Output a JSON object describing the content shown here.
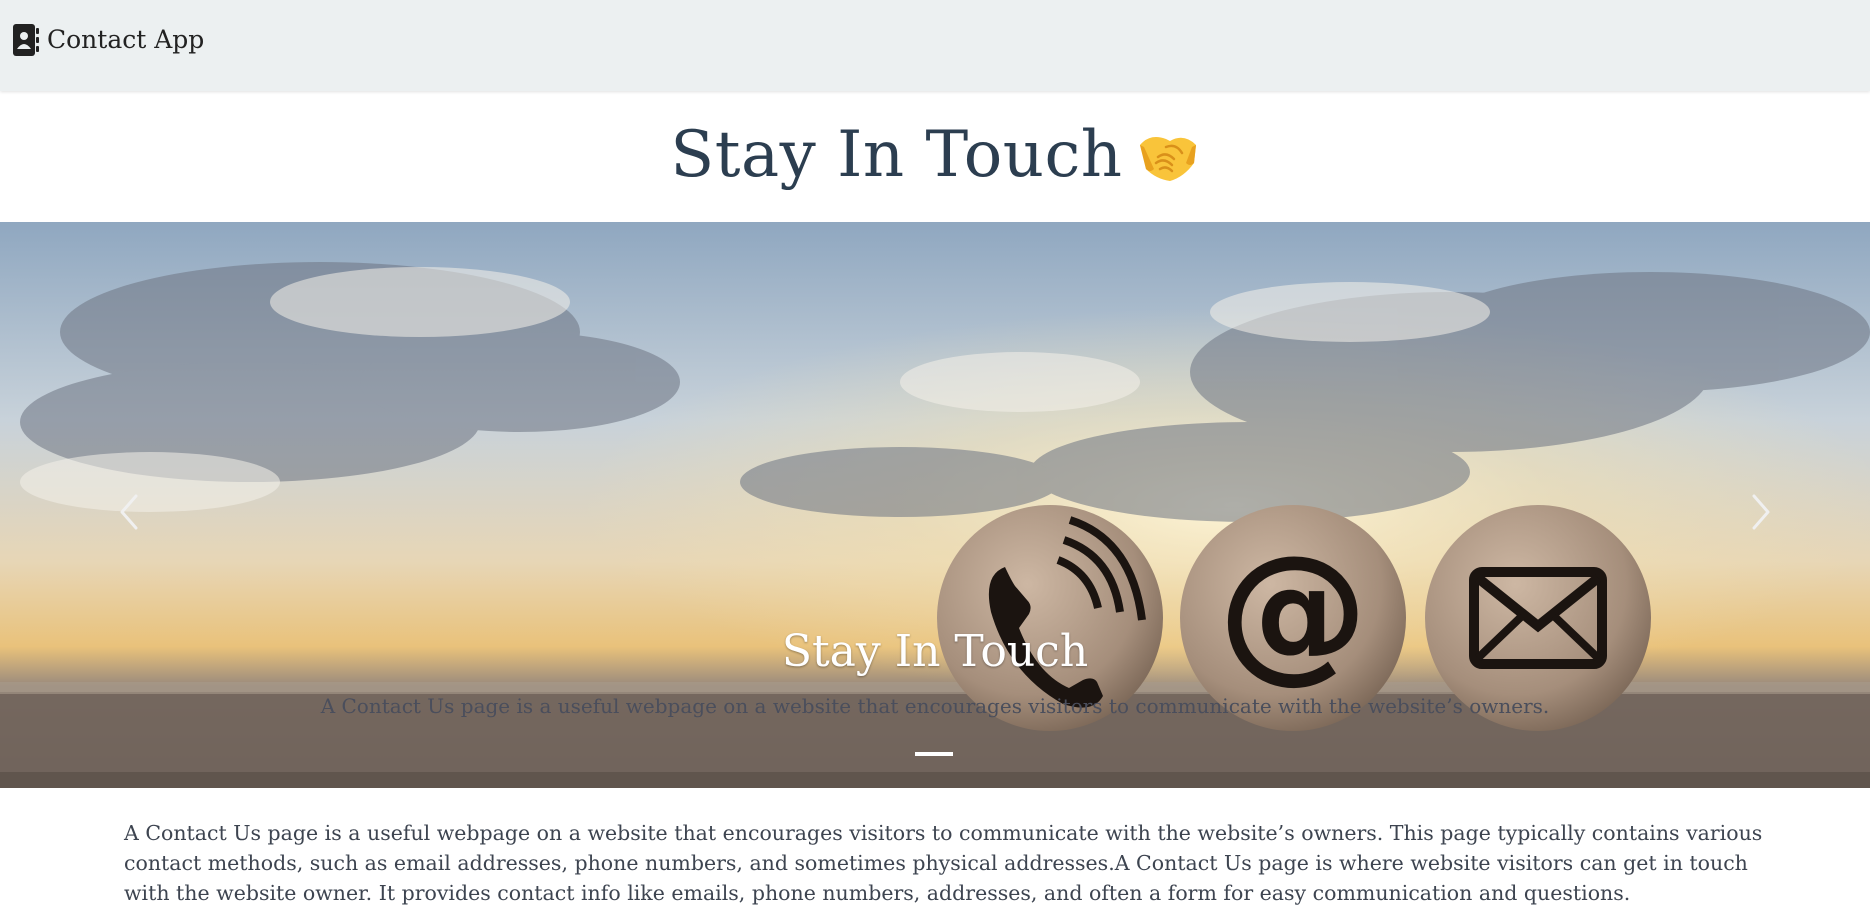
{
  "navbar": {
    "brand_text": "Contact App",
    "brand_icon": "contact-book-icon"
  },
  "header": {
    "title": "Stay In Touch",
    "emoji_icon": "handshake-icon"
  },
  "carousel": {
    "slide_image": "contact-icons-sky-image",
    "caption_title": "Stay In Touch",
    "caption_text": "A Contact Us page is a useful webpage on a website that encourages visitors to communicate with the website’s owners.",
    "prev_icon": "chevron-left-icon",
    "next_icon": "chevron-right-icon",
    "active_slide": 1,
    "slide_count": 1
  },
  "description": "A Contact Us page is a useful webpage on a website that encourages visitors to communicate with the website’s owners. This page typically contains various contact methods, such as email addresses, phone numbers, and sometimes physical addresses.A Contact Us page is where website visitors can get in touch with the website owner. It provides contact info like emails, phone numbers, addresses, and often a form for easy communication and questions.",
  "colors": {
    "navbar_bg": "#ecf0f1",
    "title_text": "#2c3e50",
    "body_text": "#3d4450"
  }
}
